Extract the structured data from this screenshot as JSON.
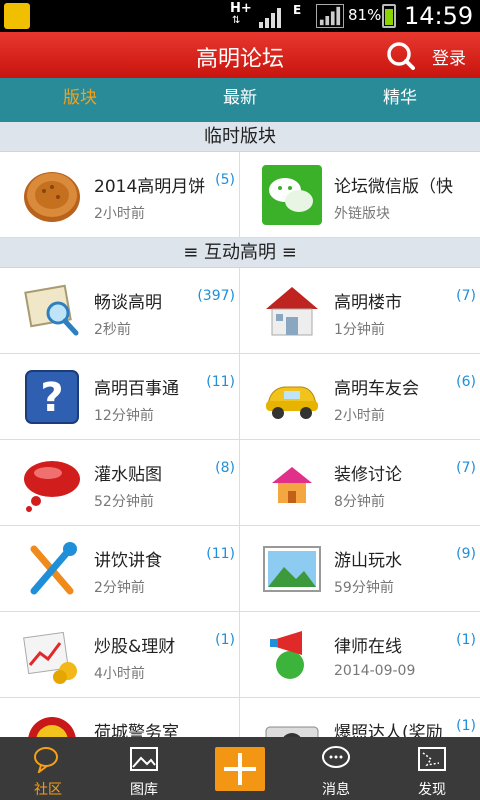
{
  "status_bar": {
    "network": "H+",
    "network2": "E",
    "battery": "81%",
    "time": "14:59"
  },
  "header": {
    "title": "高明论坛",
    "login": "登录"
  },
  "tabs": [
    {
      "label": "版块"
    },
    {
      "label": "最新"
    },
    {
      "label": "精华"
    }
  ],
  "sections": [
    {
      "title": "临时版块",
      "items": [
        {
          "title": "2014高明月饼",
          "count": "(5)",
          "sub": "2小时前",
          "icon": "mooncake-icon"
        },
        {
          "title": "论坛微信版（快",
          "count": "",
          "sub": "外链版块",
          "icon": "wechat-icon"
        }
      ]
    },
    {
      "title": "≡ 互动高明 ≡",
      "items": [
        {
          "title": "畅谈高明",
          "count": "(397)",
          "sub": "2秒前",
          "icon": "map-search-icon"
        },
        {
          "title": "高明楼市",
          "count": "(7)",
          "sub": "1分钟前",
          "icon": "house-icon"
        },
        {
          "title": "高明百事通",
          "count": "(11)",
          "sub": "12分钟前",
          "icon": "question-icon"
        },
        {
          "title": "高明车友会",
          "count": "(6)",
          "sub": "2小时前",
          "icon": "car-icon"
        },
        {
          "title": "灌水贴图",
          "count": "(8)",
          "sub": "52分钟前",
          "icon": "speech-bubble-icon"
        },
        {
          "title": "装修讨论",
          "count": "(7)",
          "sub": "8分钟前",
          "icon": "small-house-icon"
        },
        {
          "title": "讲饮讲食",
          "count": "(11)",
          "sub": "2分钟前",
          "icon": "cutlery-icon"
        },
        {
          "title": "游山玩水",
          "count": "(9)",
          "sub": "59分钟前",
          "icon": "landscape-icon"
        },
        {
          "title": "炒股&理财",
          "count": "(1)",
          "sub": "4小时前",
          "icon": "stock-chart-icon"
        },
        {
          "title": "律师在线",
          "count": "(1)",
          "sub": "2014-09-09",
          "icon": "megaphone-icon"
        },
        {
          "title": "荷城警务室",
          "count": "",
          "sub": "",
          "icon": "police-badge-icon"
        },
        {
          "title": "爆照达人(奖励",
          "count": "(1)",
          "sub": "",
          "icon": "camera-icon"
        }
      ]
    }
  ],
  "bottom_nav": [
    {
      "label": "社区",
      "icon": "community-icon"
    },
    {
      "label": "图库",
      "icon": "gallery-icon"
    },
    {
      "label": "",
      "icon": "plus-icon"
    },
    {
      "label": "消息",
      "icon": "message-icon"
    },
    {
      "label": "发现",
      "icon": "discover-icon"
    }
  ],
  "colors": {
    "header": "#d9221a",
    "tabs": "#2a8b98",
    "accent": "#f6a016",
    "count": "#1e8fd8"
  }
}
